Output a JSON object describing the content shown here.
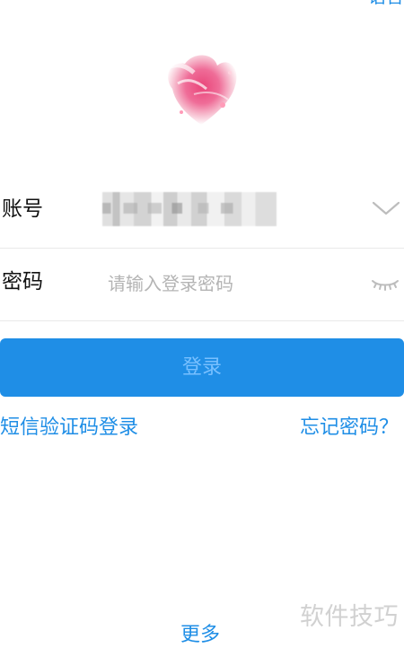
{
  "top_link": {
    "label": "语言"
  },
  "form": {
    "account": {
      "label": "账号"
    },
    "password": {
      "label": "密码",
      "placeholder": "请输入登录密码"
    }
  },
  "buttons": {
    "login": "登录"
  },
  "links": {
    "sms_login": "短信验证码登录",
    "forgot_password": "忘记密码？",
    "more": "更多"
  },
  "watermark": "软件技巧",
  "icons": {
    "account_dropdown": "chevron-down-icon",
    "password_visibility": "eye-closed-icon"
  },
  "colors": {
    "accent": "#1f8ee6",
    "button_text": "#78c0ff",
    "placeholder": "#b4b4b4",
    "divider": "#e9e9e9",
    "background": "#ffffff"
  }
}
